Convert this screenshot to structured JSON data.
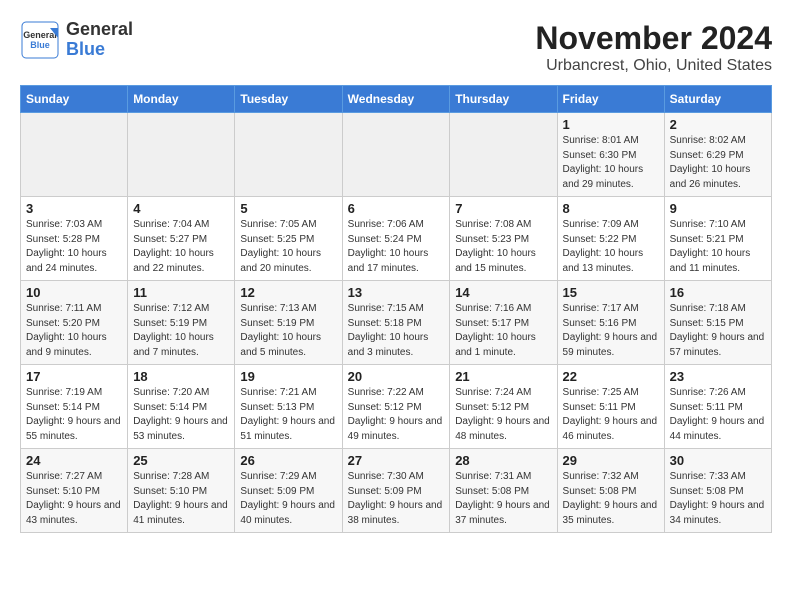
{
  "header": {
    "logo_text_line1": "General",
    "logo_text_line2": "Blue",
    "month": "November 2024",
    "location": "Urbancrest, Ohio, United States"
  },
  "weekdays": [
    "Sunday",
    "Monday",
    "Tuesday",
    "Wednesday",
    "Thursday",
    "Friday",
    "Saturday"
  ],
  "weeks": [
    [
      {
        "day": "",
        "info": ""
      },
      {
        "day": "",
        "info": ""
      },
      {
        "day": "",
        "info": ""
      },
      {
        "day": "",
        "info": ""
      },
      {
        "day": "",
        "info": ""
      },
      {
        "day": "1",
        "info": "Sunrise: 8:01 AM\nSunset: 6:30 PM\nDaylight: 10 hours and 29 minutes."
      },
      {
        "day": "2",
        "info": "Sunrise: 8:02 AM\nSunset: 6:29 PM\nDaylight: 10 hours and 26 minutes."
      }
    ],
    [
      {
        "day": "3",
        "info": "Sunrise: 7:03 AM\nSunset: 5:28 PM\nDaylight: 10 hours and 24 minutes."
      },
      {
        "day": "4",
        "info": "Sunrise: 7:04 AM\nSunset: 5:27 PM\nDaylight: 10 hours and 22 minutes."
      },
      {
        "day": "5",
        "info": "Sunrise: 7:05 AM\nSunset: 5:25 PM\nDaylight: 10 hours and 20 minutes."
      },
      {
        "day": "6",
        "info": "Sunrise: 7:06 AM\nSunset: 5:24 PM\nDaylight: 10 hours and 17 minutes."
      },
      {
        "day": "7",
        "info": "Sunrise: 7:08 AM\nSunset: 5:23 PM\nDaylight: 10 hours and 15 minutes."
      },
      {
        "day": "8",
        "info": "Sunrise: 7:09 AM\nSunset: 5:22 PM\nDaylight: 10 hours and 13 minutes."
      },
      {
        "day": "9",
        "info": "Sunrise: 7:10 AM\nSunset: 5:21 PM\nDaylight: 10 hours and 11 minutes."
      }
    ],
    [
      {
        "day": "10",
        "info": "Sunrise: 7:11 AM\nSunset: 5:20 PM\nDaylight: 10 hours and 9 minutes."
      },
      {
        "day": "11",
        "info": "Sunrise: 7:12 AM\nSunset: 5:19 PM\nDaylight: 10 hours and 7 minutes."
      },
      {
        "day": "12",
        "info": "Sunrise: 7:13 AM\nSunset: 5:19 PM\nDaylight: 10 hours and 5 minutes."
      },
      {
        "day": "13",
        "info": "Sunrise: 7:15 AM\nSunset: 5:18 PM\nDaylight: 10 hours and 3 minutes."
      },
      {
        "day": "14",
        "info": "Sunrise: 7:16 AM\nSunset: 5:17 PM\nDaylight: 10 hours and 1 minute."
      },
      {
        "day": "15",
        "info": "Sunrise: 7:17 AM\nSunset: 5:16 PM\nDaylight: 9 hours and 59 minutes."
      },
      {
        "day": "16",
        "info": "Sunrise: 7:18 AM\nSunset: 5:15 PM\nDaylight: 9 hours and 57 minutes."
      }
    ],
    [
      {
        "day": "17",
        "info": "Sunrise: 7:19 AM\nSunset: 5:14 PM\nDaylight: 9 hours and 55 minutes."
      },
      {
        "day": "18",
        "info": "Sunrise: 7:20 AM\nSunset: 5:14 PM\nDaylight: 9 hours and 53 minutes."
      },
      {
        "day": "19",
        "info": "Sunrise: 7:21 AM\nSunset: 5:13 PM\nDaylight: 9 hours and 51 minutes."
      },
      {
        "day": "20",
        "info": "Sunrise: 7:22 AM\nSunset: 5:12 PM\nDaylight: 9 hours and 49 minutes."
      },
      {
        "day": "21",
        "info": "Sunrise: 7:24 AM\nSunset: 5:12 PM\nDaylight: 9 hours and 48 minutes."
      },
      {
        "day": "22",
        "info": "Sunrise: 7:25 AM\nSunset: 5:11 PM\nDaylight: 9 hours and 46 minutes."
      },
      {
        "day": "23",
        "info": "Sunrise: 7:26 AM\nSunset: 5:11 PM\nDaylight: 9 hours and 44 minutes."
      }
    ],
    [
      {
        "day": "24",
        "info": "Sunrise: 7:27 AM\nSunset: 5:10 PM\nDaylight: 9 hours and 43 minutes."
      },
      {
        "day": "25",
        "info": "Sunrise: 7:28 AM\nSunset: 5:10 PM\nDaylight: 9 hours and 41 minutes."
      },
      {
        "day": "26",
        "info": "Sunrise: 7:29 AM\nSunset: 5:09 PM\nDaylight: 9 hours and 40 minutes."
      },
      {
        "day": "27",
        "info": "Sunrise: 7:30 AM\nSunset: 5:09 PM\nDaylight: 9 hours and 38 minutes."
      },
      {
        "day": "28",
        "info": "Sunrise: 7:31 AM\nSunset: 5:08 PM\nDaylight: 9 hours and 37 minutes."
      },
      {
        "day": "29",
        "info": "Sunrise: 7:32 AM\nSunset: 5:08 PM\nDaylight: 9 hours and 35 minutes."
      },
      {
        "day": "30",
        "info": "Sunrise: 7:33 AM\nSunset: 5:08 PM\nDaylight: 9 hours and 34 minutes."
      }
    ]
  ]
}
